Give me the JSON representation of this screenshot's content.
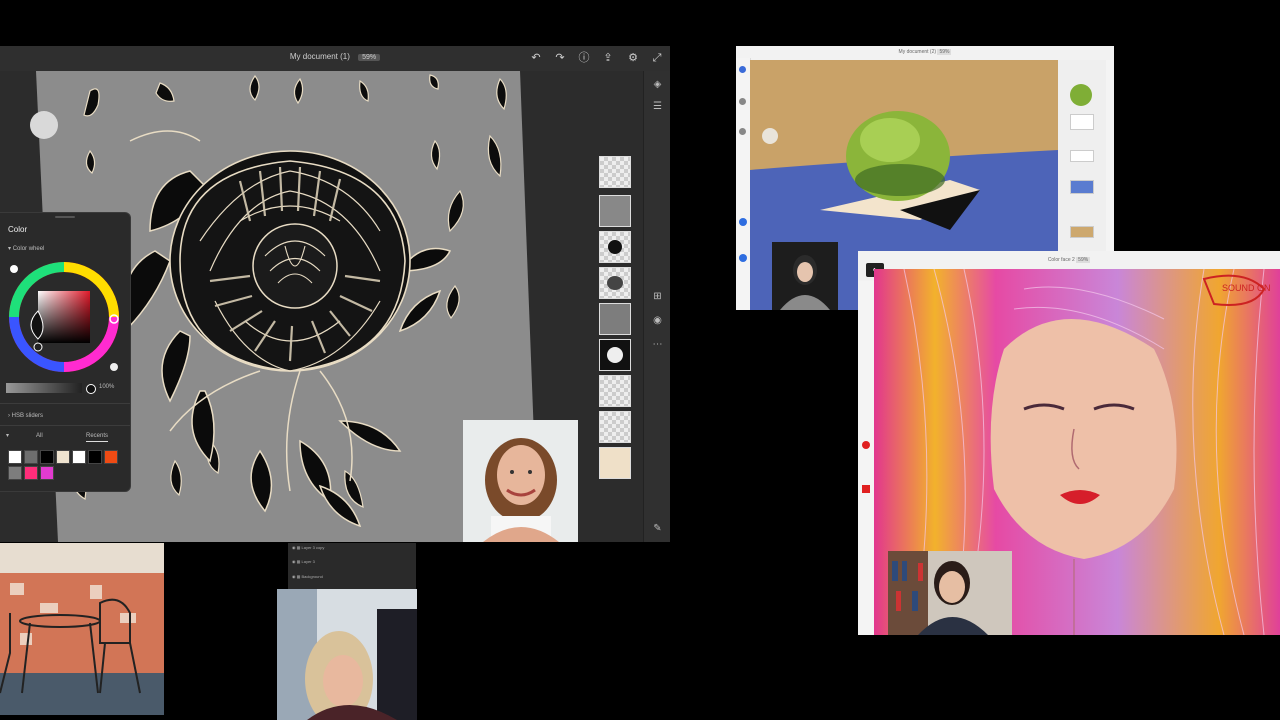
{
  "main_window": {
    "title": "My document (1)",
    "zoom": "59%",
    "toolbar_icons": [
      "undo-icon",
      "redo-icon",
      "help-icon",
      "share-icon",
      "settings-icon",
      "fullscreen-icon"
    ]
  },
  "color_panel": {
    "title": "Color",
    "color_wheel_label": "Color wheel",
    "opacity": "100%",
    "hsb_label": "HSB sliders",
    "tab_all": "All",
    "tab_recents": "Recents",
    "recent_colors": [
      "#ffffff",
      "#6e6e6e",
      "#000000",
      "#efe3cf",
      "#ffffff",
      "#000000",
      "#ef4b14",
      "#7d7d7d",
      "#ff2d7a",
      "#e23bcf"
    ]
  },
  "layers_panel_small": {
    "items": [
      "Layer 3 copy",
      "Layer 3",
      "Background"
    ]
  },
  "window_2": {
    "title": "My document (2)",
    "zoom": "59%"
  },
  "window_3": {
    "title": "Color face 2",
    "zoom": "59%",
    "handwritten_note": "SOUND ON"
  },
  "colors": {
    "canvas_gray": "#8a8a8a",
    "panel_bg": "#2a2a2a",
    "accent_red": "#e02020"
  }
}
